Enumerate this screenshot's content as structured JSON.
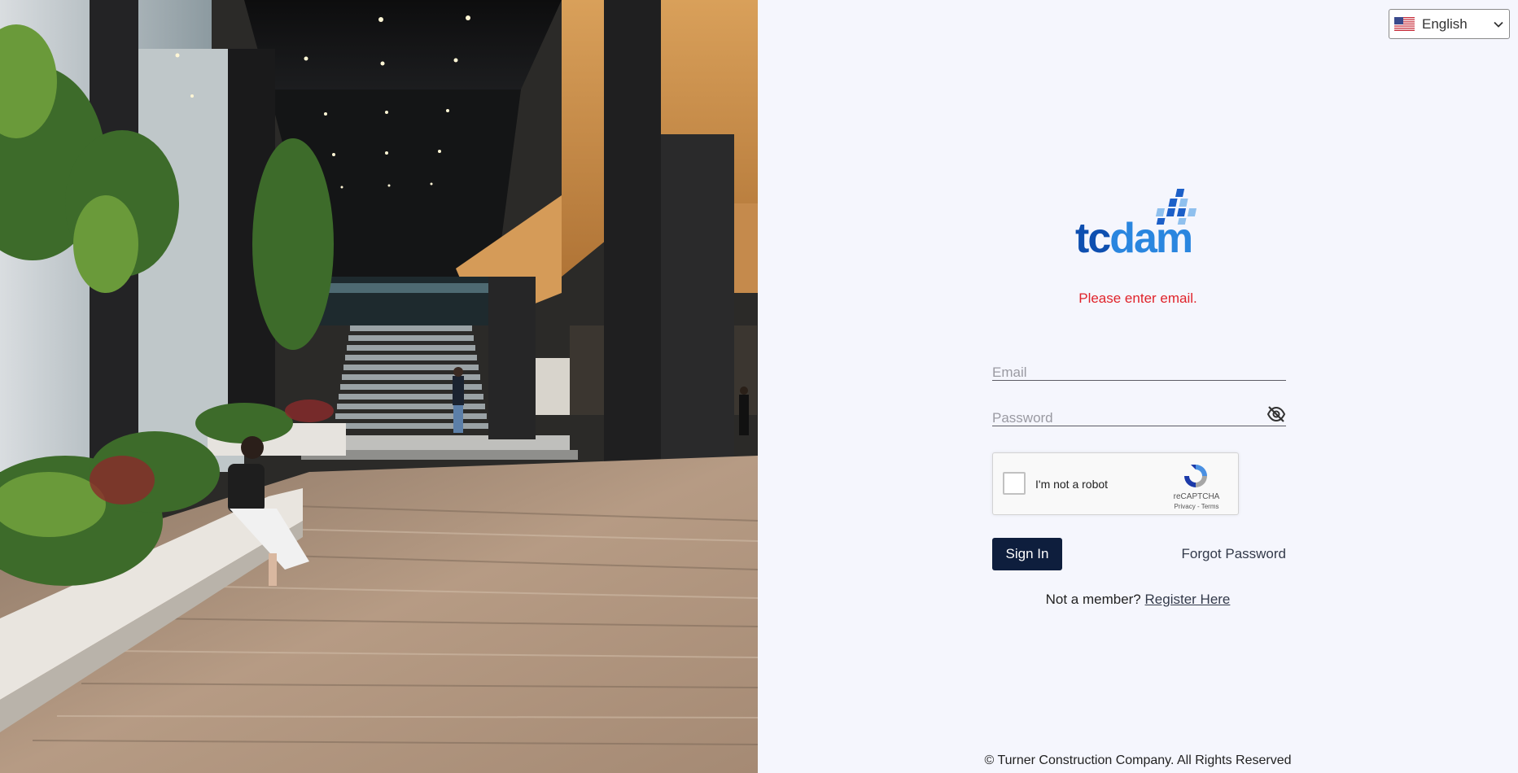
{
  "language": {
    "selected": "English",
    "icon": "us-flag-icon"
  },
  "brand": {
    "logo_text": "tcdam",
    "primary_color": "#0e68c8",
    "light_color": "#8fc0ee"
  },
  "login": {
    "error_message": "Please enter email.",
    "email_placeholder": "Email",
    "password_placeholder": "Password",
    "password_toggle_icon": "eye-off-icon",
    "sign_in_label": "Sign In",
    "forgot_password_label": "Forgot Password",
    "not_member_text": "Not a member?",
    "register_label": "Register Here"
  },
  "captcha": {
    "label": "I'm not a robot",
    "brand": "reCAPTCHA",
    "links": "Privacy - Terms"
  },
  "footer": {
    "copyright": "© Turner Construction Company. All Rights Reserved"
  },
  "colors": {
    "error": "#e0232b",
    "button": "#0e1e3d",
    "background": "#f5f6fd"
  }
}
